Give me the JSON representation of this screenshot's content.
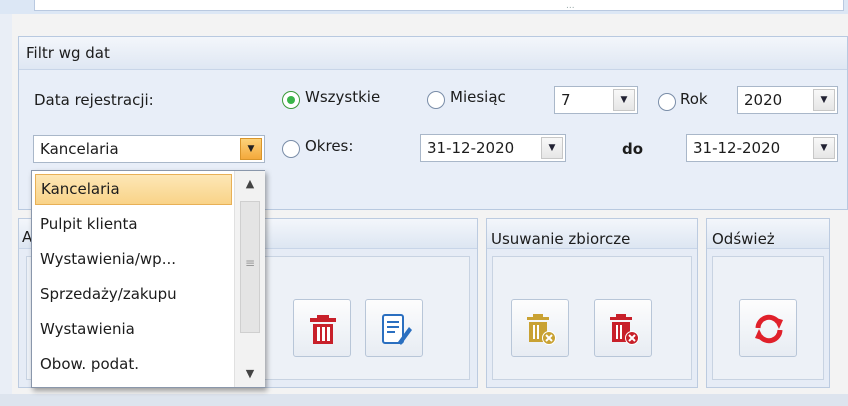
{
  "filter": {
    "title": "Filtr wg dat",
    "registration_label": "Data rejestracji:",
    "radio_all": "Wszystkie",
    "radio_month": "Miesiąc",
    "month_value": "7",
    "radio_year": "Rok",
    "year_value": "2020",
    "radio_period": "Okres:",
    "date_from": "31-12-2020",
    "to_label": "do",
    "date_to": "31-12-2020",
    "source_value": "Kancelaria",
    "selected_radio": "Wszystkie"
  },
  "dropdown": {
    "items": [
      "Kancelaria",
      "Pulpit klienta",
      "Wystawienia/wp...",
      "Sprzedaży/zakupu",
      "Wystawienia",
      "Obow. podat."
    ],
    "selected": "Kancelaria"
  },
  "groups": {
    "first_title_fragment": "A",
    "bulk_delete_title": "Usuwanie zbiorcze",
    "refresh_title": "Odśwież"
  },
  "top": {
    "grip": "..."
  },
  "colors": {
    "accent_blue": "#dce7f5",
    "delete_red": "#c8202a",
    "radio_green": "#39b54a",
    "refresh_red": "#e0202a"
  }
}
